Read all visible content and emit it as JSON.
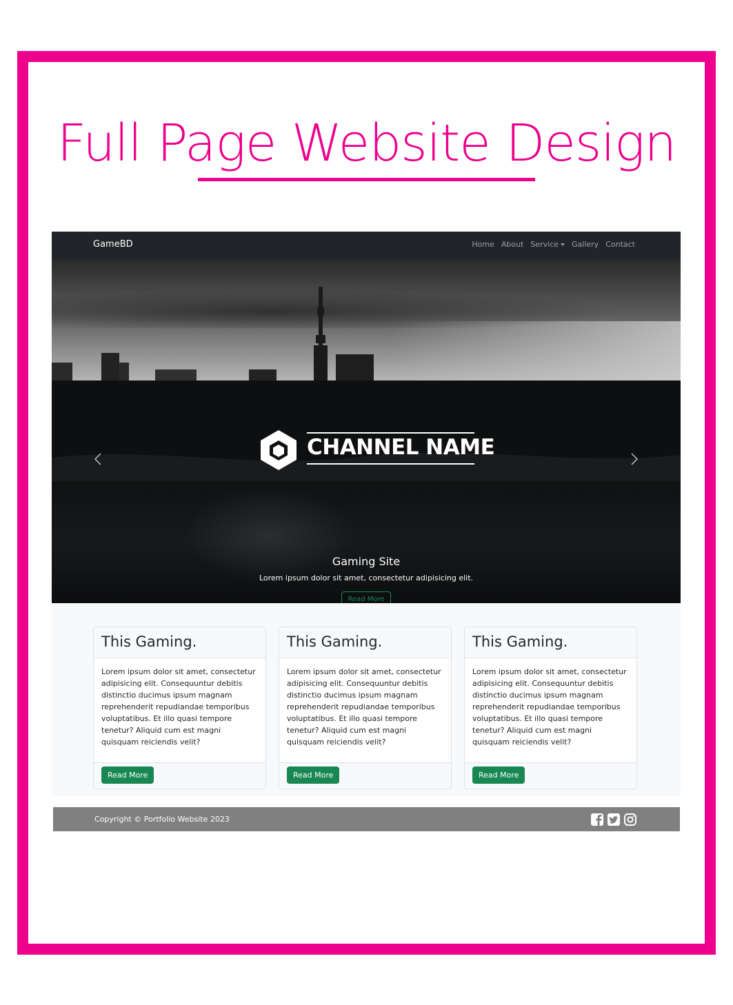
{
  "page": {
    "title": "Full Page Website Design"
  },
  "navbar": {
    "brand": "GameBD",
    "links": [
      {
        "label": "Home"
      },
      {
        "label": "About"
      },
      {
        "label": "Service"
      },
      {
        "label": "Gallery"
      },
      {
        "label": "Contact"
      }
    ]
  },
  "hero": {
    "logo_text": "CHANNEL NAME",
    "caption_title": "Gaming Site",
    "caption_text": "Lorem ipsum dolor sit amet, consectetur adipisicing elit.",
    "button_label": "Read More",
    "slide_count": 3,
    "active_slide": 1
  },
  "cards": [
    {
      "title": "This Gaming.",
      "text": "Lorem ipsum dolor sit amet, consectetur adipisicing elit. Consequuntur debitis distinctio ducimus ipsum magnam reprehenderit repudiandae temporibus voluptatibus. Et illo quasi tempore tenetur? Aliquid cum est magni quisquam reiciendis velit?",
      "button_label": "Read More"
    },
    {
      "title": "This Gaming.",
      "text": "Lorem ipsum dolor sit amet, consectetur adipisicing elit. Consequuntur debitis distinctio ducimus ipsum magnam reprehenderit repudiandae temporibus voluptatibus. Et illo quasi tempore tenetur? Aliquid cum est magni quisquam reiciendis velit?",
      "button_label": "Read More"
    },
    {
      "title": "This Gaming.",
      "text": "Lorem ipsum dolor sit amet, consectetur adipisicing elit. Consequuntur debitis distinctio ducimus ipsum magnam reprehenderit repudiandae temporibus voluptatibus. Et illo quasi tempore tenetur? Aliquid cum est magni quisquam reiciendis velit?",
      "button_label": "Read More"
    }
  ],
  "footer": {
    "copyright": "Copyright © Portfolio Website 2023",
    "social_icons": [
      "facebook-icon",
      "twitter-icon",
      "instagram-icon"
    ]
  },
  "colors": {
    "accent": "#ec008c",
    "navbar_bg": "#212529",
    "success": "#198754",
    "footer_bg": "#808080",
    "section_bg": "#f8f9fa"
  }
}
